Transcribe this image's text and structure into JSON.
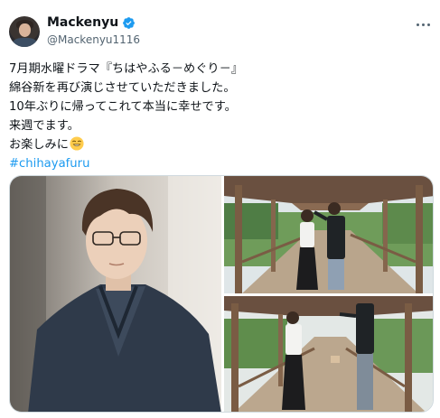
{
  "author": {
    "display_name": "Mackenyu",
    "handle": "@Mackenyu1116",
    "verified": true,
    "avatar_icon": "profile-photo"
  },
  "tweet": {
    "lines": [
      "7月期水曜ドラマ『ちはやふる－めぐり－』",
      "綿谷新を再び演じさせていただきました。",
      "10年ぶりに帰ってこれて本当に幸せです。",
      "来週でます。",
      "お楽しみに"
    ],
    "emoji": "smiling-face-emoji",
    "hashtag": "#chihayafuru"
  },
  "media": {
    "photos": [
      {
        "subject": "portrait in dark kimono with glasses"
      },
      {
        "subject": "two people playing on wooden corridor"
      },
      {
        "subject": "two people on wooden corridor with garden"
      }
    ]
  },
  "colors": {
    "link": "#1d9bf0",
    "verified_badge": "#1d9bf0",
    "secondary_text": "#536471",
    "primary_text": "#0f1419",
    "border": "#cfd9de"
  },
  "icons": {
    "more": "more-options-icon",
    "verified": "verified-badge-icon"
  }
}
